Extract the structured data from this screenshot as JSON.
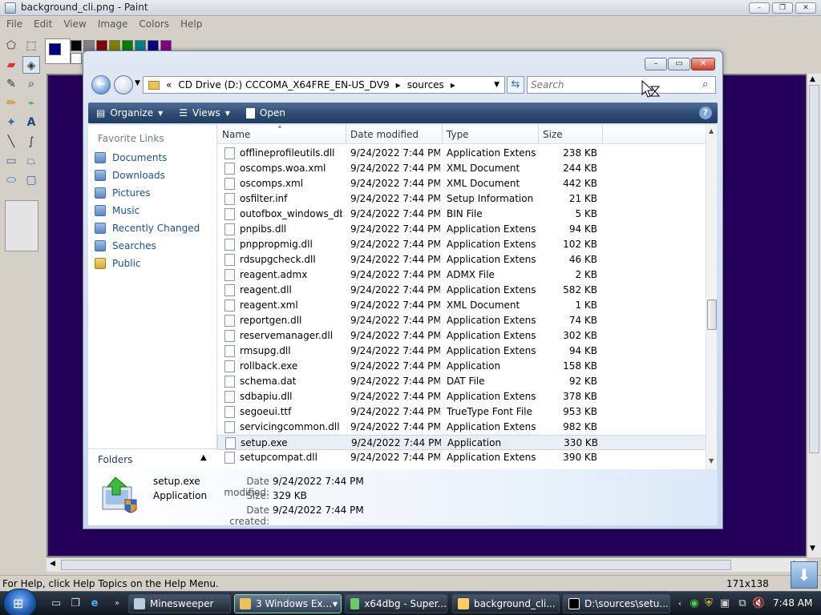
{
  "paint": {
    "title": "background_cli.png - Paint",
    "menu": [
      "File",
      "Edit",
      "View",
      "Image",
      "Colors",
      "Help"
    ],
    "status_text": "For Help, click Help Topics on the Help Menu.",
    "canvas_size": "171x138",
    "palette": [
      "#000000",
      "#808080",
      "#800000",
      "#808000",
      "#008000",
      "#008080",
      "#000080",
      "#800080",
      "#ffffff",
      "#c0c0c0",
      "#ff0000",
      "#ffff00",
      "#00ff00",
      "#00ffff",
      "#0000ff",
      "#ff00ff"
    ]
  },
  "explorer": {
    "breadcrumb": {
      "overflow": "«",
      "drive": "CD Drive (D:) CCCOMA_X64FRE_EN-US_DV9",
      "folder": "sources"
    },
    "search_placeholder": "Search",
    "commands": {
      "organize": "Organize",
      "views": "Views",
      "open": "Open"
    },
    "favorite_links_header": "Favorite Links",
    "favorite_links": [
      "Documents",
      "Downloads",
      "Pictures",
      "Music",
      "Recently Changed",
      "Searches",
      "Public"
    ],
    "folders_label": "Folders",
    "columns": {
      "name": "Name",
      "date": "Date modified",
      "type": "Type",
      "size": "Size"
    },
    "files": [
      {
        "name": "offlineprofileutils.dll",
        "date": "9/24/2022 7:44 PM",
        "type": "Application Extens...",
        "size": "238 KB"
      },
      {
        "name": "oscomps.woa.xml",
        "date": "9/24/2022 7:44 PM",
        "type": "XML Document",
        "size": "244 KB"
      },
      {
        "name": "oscomps.xml",
        "date": "9/24/2022 7:44 PM",
        "type": "XML Document",
        "size": "442 KB"
      },
      {
        "name": "osfilter.inf",
        "date": "9/24/2022 7:44 PM",
        "type": "Setup Information",
        "size": "21 KB"
      },
      {
        "name": "outofbox_windows_db...",
        "date": "9/24/2022 7:44 PM",
        "type": "BIN File",
        "size": "5 KB"
      },
      {
        "name": "pnpibs.dll",
        "date": "9/24/2022 7:44 PM",
        "type": "Application Extens...",
        "size": "94 KB"
      },
      {
        "name": "pnppropmig.dll",
        "date": "9/24/2022 7:44 PM",
        "type": "Application Extens...",
        "size": "102 KB"
      },
      {
        "name": "rdsupgcheck.dll",
        "date": "9/24/2022 7:44 PM",
        "type": "Application Extens...",
        "size": "46 KB"
      },
      {
        "name": "reagent.admx",
        "date": "9/24/2022 7:44 PM",
        "type": "ADMX File",
        "size": "2 KB"
      },
      {
        "name": "reagent.dll",
        "date": "9/24/2022 7:44 PM",
        "type": "Application Extens...",
        "size": "582 KB"
      },
      {
        "name": "reagent.xml",
        "date": "9/24/2022 7:44 PM",
        "type": "XML Document",
        "size": "1 KB"
      },
      {
        "name": "reportgen.dll",
        "date": "9/24/2022 7:44 PM",
        "type": "Application Extens...",
        "size": "74 KB"
      },
      {
        "name": "reservemanager.dll",
        "date": "9/24/2022 7:44 PM",
        "type": "Application Extens...",
        "size": "302 KB"
      },
      {
        "name": "rmsupg.dll",
        "date": "9/24/2022 7:44 PM",
        "type": "Application Extens...",
        "size": "94 KB"
      },
      {
        "name": "rollback.exe",
        "date": "9/24/2022 7:44 PM",
        "type": "Application",
        "size": "158 KB"
      },
      {
        "name": "schema.dat",
        "date": "9/24/2022 7:44 PM",
        "type": "DAT File",
        "size": "92 KB"
      },
      {
        "name": "sdbapiu.dll",
        "date": "9/24/2022 7:44 PM",
        "type": "Application Extens...",
        "size": "378 KB"
      },
      {
        "name": "segoeui.ttf",
        "date": "9/24/2022 7:44 PM",
        "type": "TrueType Font File",
        "size": "953 KB"
      },
      {
        "name": "servicingcommon.dll",
        "date": "9/24/2022 7:44 PM",
        "type": "Application Extens...",
        "size": "982 KB"
      },
      {
        "name": "setup.exe",
        "date": "9/24/2022 7:44 PM",
        "type": "Application",
        "size": "330 KB",
        "selected": true
      },
      {
        "name": "setupcompat.dll",
        "date": "9/24/2022 7:44 PM",
        "type": "Application Extens...",
        "size": "390 KB"
      }
    ],
    "details": {
      "name": "setup.exe",
      "type": "Application",
      "modified_label": "Date modified:",
      "modified": "9/24/2022 7:44 PM",
      "size_label": "Size:",
      "size": "329 KB",
      "created_label": "Date created:",
      "created": "9/24/2022 7:44 PM"
    }
  },
  "taskbar": {
    "items": [
      "Minesweeper",
      "3 Windows Ex...",
      "x64dbg - Super...",
      "background_cli...",
      "D:\\sources\\setu..."
    ],
    "clock": "7:48 AM"
  }
}
